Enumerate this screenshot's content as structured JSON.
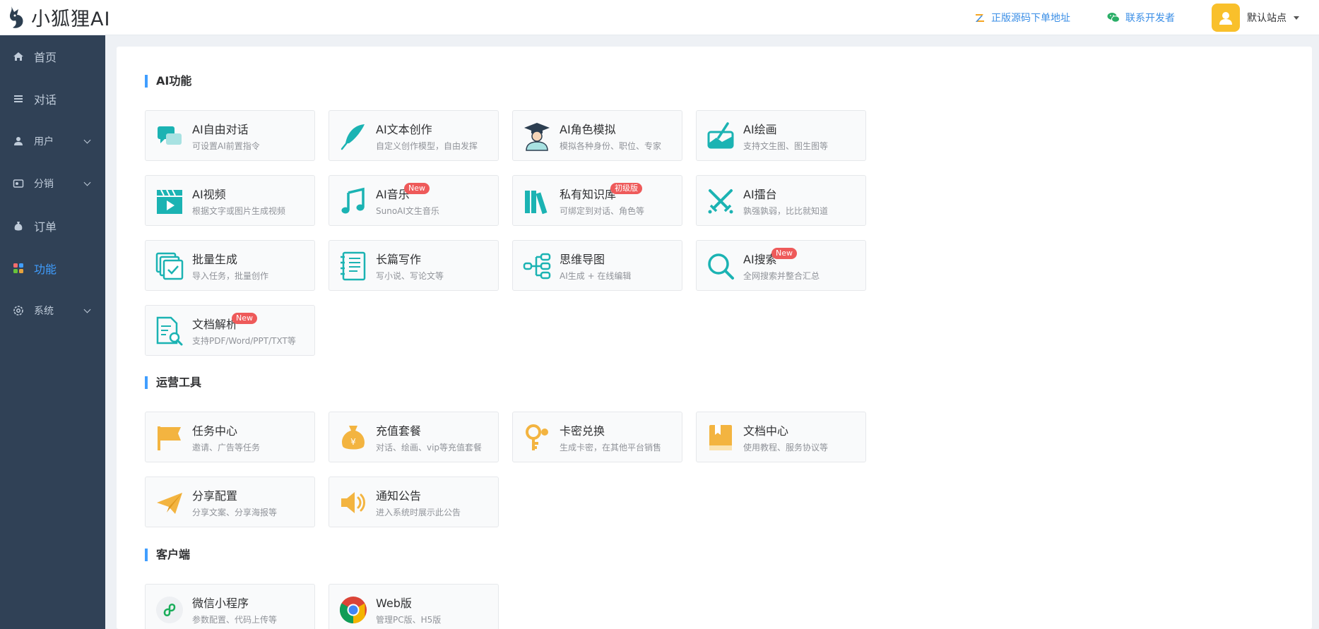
{
  "header": {
    "logo_text": "小狐狸AI",
    "source_link": "正版源码下单地址",
    "contact_link": "联系开发者",
    "site_name": "默认站点"
  },
  "sidebar": {
    "items": [
      {
        "label": "首页"
      },
      {
        "label": "对话"
      },
      {
        "label": "用户"
      },
      {
        "label": "分销"
      },
      {
        "label": "订单"
      },
      {
        "label": "功能"
      },
      {
        "label": "系统"
      }
    ]
  },
  "sections": {
    "ai": {
      "title": "AI功能",
      "cards": [
        {
          "title": "AI自由对话",
          "desc": "可设置AI前置指令",
          "icon": "chat-bubbles-icon"
        },
        {
          "title": "AI文本创作",
          "desc": "自定义创作模型，自由发挥",
          "icon": "feather-pen-icon"
        },
        {
          "title": "AI角色模拟",
          "desc": "模拟各种身份、职位、专家",
          "icon": "graduate-icon"
        },
        {
          "title": "AI绘画",
          "desc": "支持文生图、图生图等",
          "icon": "paint-brush-icon"
        },
        {
          "title": "AI视频",
          "desc": "根据文字或图片生成视频",
          "icon": "video-clapper-icon"
        },
        {
          "title": "AI音乐",
          "desc": "SunoAI文生音乐",
          "icon": "music-note-icon",
          "badge": "New"
        },
        {
          "title": "私有知识库",
          "desc": "可绑定到对话、角色等",
          "icon": "books-icon",
          "badge": "初级版"
        },
        {
          "title": "AI擂台",
          "desc": "孰强孰弱，比比就知道",
          "icon": "crossed-swords-icon"
        },
        {
          "title": "批量生成",
          "desc": "导入任务，批量创作",
          "icon": "batch-check-icon"
        },
        {
          "title": "长篇写作",
          "desc": "写小说、写论文等",
          "icon": "notebook-icon"
        },
        {
          "title": "思维导图",
          "desc": "AI生成 + 在线编辑",
          "icon": "mindmap-icon"
        },
        {
          "title": "AI搜索",
          "desc": "全网搜索并整合汇总",
          "icon": "search-icon",
          "badge": "New"
        },
        {
          "title": "文档解析",
          "desc": "支持PDF/Word/PPT/TXT等",
          "icon": "document-search-icon",
          "badge": "New"
        }
      ]
    },
    "ops": {
      "title": "运营工具",
      "cards": [
        {
          "title": "任务中心",
          "desc": "邀请、广告等任务",
          "icon": "flag-icon"
        },
        {
          "title": "充值套餐",
          "desc": "对话、绘画、vip等充值套餐",
          "icon": "money-bag-icon"
        },
        {
          "title": "卡密兑换",
          "desc": "生成卡密，在其他平台销售",
          "icon": "key-icon"
        },
        {
          "title": "文档中心",
          "desc": "使用教程、服务协议等",
          "icon": "book-icon"
        },
        {
          "title": "分享配置",
          "desc": "分享文案、分享海报等",
          "icon": "paper-plane-icon"
        },
        {
          "title": "通知公告",
          "desc": "进入系统时展示此公告",
          "icon": "speaker-icon"
        }
      ]
    },
    "client": {
      "title": "客户端",
      "cards": [
        {
          "title": "微信小程序",
          "desc": "参数配置、代码上传等",
          "icon": "mini-program-icon"
        },
        {
          "title": "Web版",
          "desc": "管理PC版、H5版",
          "icon": "chrome-icon"
        }
      ]
    }
  },
  "colors": {
    "sidebar_bg": "#304156",
    "active": "#409eff",
    "teal": "#1bb3b3",
    "orange": "#f3b440",
    "badge": "#ee5a5a"
  }
}
